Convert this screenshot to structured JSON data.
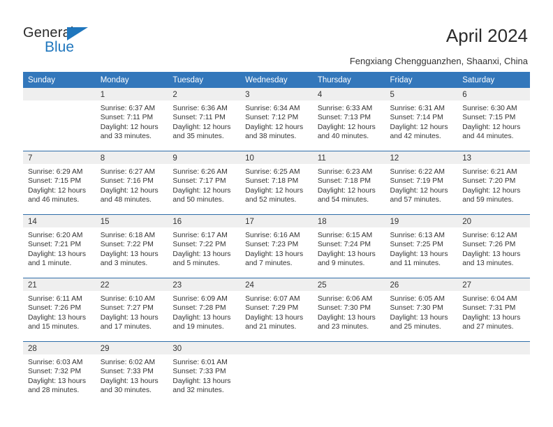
{
  "brand": {
    "name_part1": "General",
    "name_part2": "Blue",
    "triangle_color": "#1f76bd"
  },
  "header": {
    "title": "April 2024",
    "subtitle": "Fengxiang Chengguanzhen, Shaanxi, China",
    "header_bg_color": "#3377bb",
    "week_divider_color": "#2e6da8",
    "daynum_band_color": "#efefef"
  },
  "calendar": {
    "weekday_headers": [
      "Sunday",
      "Monday",
      "Tuesday",
      "Wednesday",
      "Thursday",
      "Friday",
      "Saturday"
    ],
    "weeks": [
      [
        {
          "day": "",
          "sunrise": "",
          "sunset": "",
          "daylight_line1": "",
          "daylight_line2": ""
        },
        {
          "day": "1",
          "sunrise": "Sunrise: 6:37 AM",
          "sunset": "Sunset: 7:11 PM",
          "daylight_line1": "Daylight: 12 hours",
          "daylight_line2": "and 33 minutes."
        },
        {
          "day": "2",
          "sunrise": "Sunrise: 6:36 AM",
          "sunset": "Sunset: 7:11 PM",
          "daylight_line1": "Daylight: 12 hours",
          "daylight_line2": "and 35 minutes."
        },
        {
          "day": "3",
          "sunrise": "Sunrise: 6:34 AM",
          "sunset": "Sunset: 7:12 PM",
          "daylight_line1": "Daylight: 12 hours",
          "daylight_line2": "and 38 minutes."
        },
        {
          "day": "4",
          "sunrise": "Sunrise: 6:33 AM",
          "sunset": "Sunset: 7:13 PM",
          "daylight_line1": "Daylight: 12 hours",
          "daylight_line2": "and 40 minutes."
        },
        {
          "day": "5",
          "sunrise": "Sunrise: 6:31 AM",
          "sunset": "Sunset: 7:14 PM",
          "daylight_line1": "Daylight: 12 hours",
          "daylight_line2": "and 42 minutes."
        },
        {
          "day": "6",
          "sunrise": "Sunrise: 6:30 AM",
          "sunset": "Sunset: 7:15 PM",
          "daylight_line1": "Daylight: 12 hours",
          "daylight_line2": "and 44 minutes."
        }
      ],
      [
        {
          "day": "7",
          "sunrise": "Sunrise: 6:29 AM",
          "sunset": "Sunset: 7:15 PM",
          "daylight_line1": "Daylight: 12 hours",
          "daylight_line2": "and 46 minutes."
        },
        {
          "day": "8",
          "sunrise": "Sunrise: 6:27 AM",
          "sunset": "Sunset: 7:16 PM",
          "daylight_line1": "Daylight: 12 hours",
          "daylight_line2": "and 48 minutes."
        },
        {
          "day": "9",
          "sunrise": "Sunrise: 6:26 AM",
          "sunset": "Sunset: 7:17 PM",
          "daylight_line1": "Daylight: 12 hours",
          "daylight_line2": "and 50 minutes."
        },
        {
          "day": "10",
          "sunrise": "Sunrise: 6:25 AM",
          "sunset": "Sunset: 7:18 PM",
          "daylight_line1": "Daylight: 12 hours",
          "daylight_line2": "and 52 minutes."
        },
        {
          "day": "11",
          "sunrise": "Sunrise: 6:23 AM",
          "sunset": "Sunset: 7:18 PM",
          "daylight_line1": "Daylight: 12 hours",
          "daylight_line2": "and 54 minutes."
        },
        {
          "day": "12",
          "sunrise": "Sunrise: 6:22 AM",
          "sunset": "Sunset: 7:19 PM",
          "daylight_line1": "Daylight: 12 hours",
          "daylight_line2": "and 57 minutes."
        },
        {
          "day": "13",
          "sunrise": "Sunrise: 6:21 AM",
          "sunset": "Sunset: 7:20 PM",
          "daylight_line1": "Daylight: 12 hours",
          "daylight_line2": "and 59 minutes."
        }
      ],
      [
        {
          "day": "14",
          "sunrise": "Sunrise: 6:20 AM",
          "sunset": "Sunset: 7:21 PM",
          "daylight_line1": "Daylight: 13 hours",
          "daylight_line2": "and 1 minute."
        },
        {
          "day": "15",
          "sunrise": "Sunrise: 6:18 AM",
          "sunset": "Sunset: 7:22 PM",
          "daylight_line1": "Daylight: 13 hours",
          "daylight_line2": "and 3 minutes."
        },
        {
          "day": "16",
          "sunrise": "Sunrise: 6:17 AM",
          "sunset": "Sunset: 7:22 PM",
          "daylight_line1": "Daylight: 13 hours",
          "daylight_line2": "and 5 minutes."
        },
        {
          "day": "17",
          "sunrise": "Sunrise: 6:16 AM",
          "sunset": "Sunset: 7:23 PM",
          "daylight_line1": "Daylight: 13 hours",
          "daylight_line2": "and 7 minutes."
        },
        {
          "day": "18",
          "sunrise": "Sunrise: 6:15 AM",
          "sunset": "Sunset: 7:24 PM",
          "daylight_line1": "Daylight: 13 hours",
          "daylight_line2": "and 9 minutes."
        },
        {
          "day": "19",
          "sunrise": "Sunrise: 6:13 AM",
          "sunset": "Sunset: 7:25 PM",
          "daylight_line1": "Daylight: 13 hours",
          "daylight_line2": "and 11 minutes."
        },
        {
          "day": "20",
          "sunrise": "Sunrise: 6:12 AM",
          "sunset": "Sunset: 7:26 PM",
          "daylight_line1": "Daylight: 13 hours",
          "daylight_line2": "and 13 minutes."
        }
      ],
      [
        {
          "day": "21",
          "sunrise": "Sunrise: 6:11 AM",
          "sunset": "Sunset: 7:26 PM",
          "daylight_line1": "Daylight: 13 hours",
          "daylight_line2": "and 15 minutes."
        },
        {
          "day": "22",
          "sunrise": "Sunrise: 6:10 AM",
          "sunset": "Sunset: 7:27 PM",
          "daylight_line1": "Daylight: 13 hours",
          "daylight_line2": "and 17 minutes."
        },
        {
          "day": "23",
          "sunrise": "Sunrise: 6:09 AM",
          "sunset": "Sunset: 7:28 PM",
          "daylight_line1": "Daylight: 13 hours",
          "daylight_line2": "and 19 minutes."
        },
        {
          "day": "24",
          "sunrise": "Sunrise: 6:07 AM",
          "sunset": "Sunset: 7:29 PM",
          "daylight_line1": "Daylight: 13 hours",
          "daylight_line2": "and 21 minutes."
        },
        {
          "day": "25",
          "sunrise": "Sunrise: 6:06 AM",
          "sunset": "Sunset: 7:30 PM",
          "daylight_line1": "Daylight: 13 hours",
          "daylight_line2": "and 23 minutes."
        },
        {
          "day": "26",
          "sunrise": "Sunrise: 6:05 AM",
          "sunset": "Sunset: 7:30 PM",
          "daylight_line1": "Daylight: 13 hours",
          "daylight_line2": "and 25 minutes."
        },
        {
          "day": "27",
          "sunrise": "Sunrise: 6:04 AM",
          "sunset": "Sunset: 7:31 PM",
          "daylight_line1": "Daylight: 13 hours",
          "daylight_line2": "and 27 minutes."
        }
      ],
      [
        {
          "day": "28",
          "sunrise": "Sunrise: 6:03 AM",
          "sunset": "Sunset: 7:32 PM",
          "daylight_line1": "Daylight: 13 hours",
          "daylight_line2": "and 28 minutes."
        },
        {
          "day": "29",
          "sunrise": "Sunrise: 6:02 AM",
          "sunset": "Sunset: 7:33 PM",
          "daylight_line1": "Daylight: 13 hours",
          "daylight_line2": "and 30 minutes."
        },
        {
          "day": "30",
          "sunrise": "Sunrise: 6:01 AM",
          "sunset": "Sunset: 7:33 PM",
          "daylight_line1": "Daylight: 13 hours",
          "daylight_line2": "and 32 minutes."
        },
        {
          "day": "",
          "sunrise": "",
          "sunset": "",
          "daylight_line1": "",
          "daylight_line2": ""
        },
        {
          "day": "",
          "sunrise": "",
          "sunset": "",
          "daylight_line1": "",
          "daylight_line2": ""
        },
        {
          "day": "",
          "sunrise": "",
          "sunset": "",
          "daylight_line1": "",
          "daylight_line2": ""
        },
        {
          "day": "",
          "sunrise": "",
          "sunset": "",
          "daylight_line1": "",
          "daylight_line2": ""
        }
      ]
    ]
  }
}
